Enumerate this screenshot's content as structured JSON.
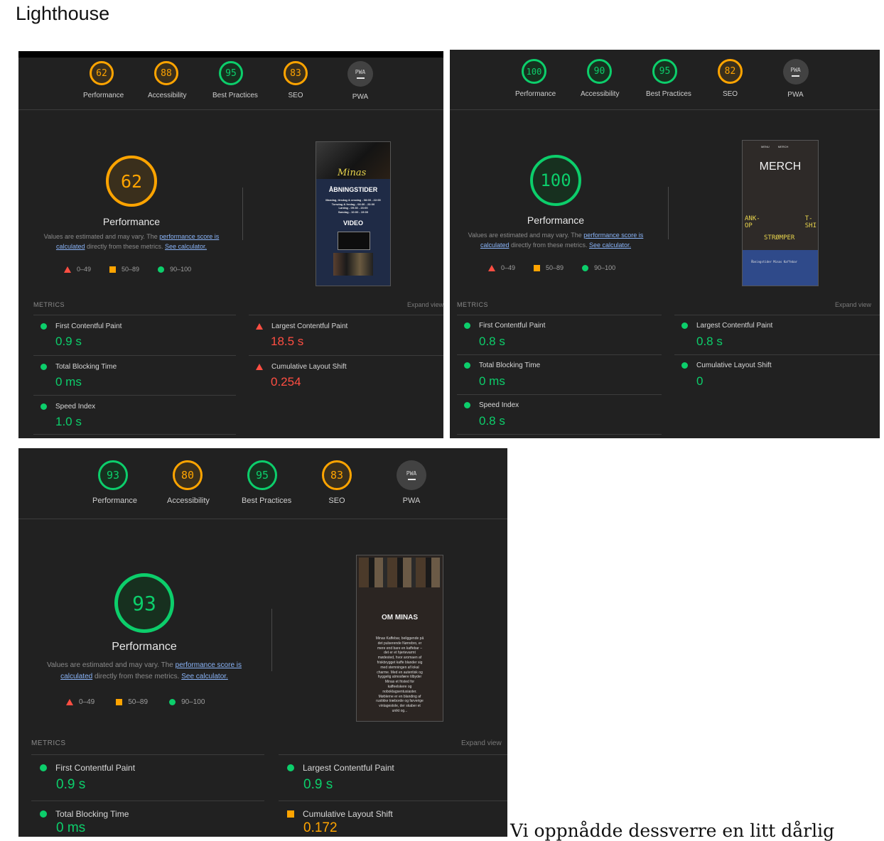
{
  "heading": "Lighthouse",
  "panels": [
    {
      "gauges": [
        {
          "score": "62",
          "label": "Performance"
        },
        {
          "score": "88",
          "label": "Accessibility"
        },
        {
          "score": "95",
          "label": "Best Practices"
        },
        {
          "score": "83",
          "label": "SEO"
        },
        {
          "score": "PWA",
          "label": "PWA"
        }
      ],
      "main_score": "62",
      "main_label": "Performance",
      "note_pre": "Values are estimated and may vary. The ",
      "note_link1": "performance score is calculated",
      "note_mid": " directly from these metrics. ",
      "note_link2": "See calculator.",
      "legend": [
        "0–49",
        "50–89",
        "90–100"
      ],
      "metrics_label": "METRICS",
      "expand": "Expand view",
      "metrics": [
        {
          "name": "First Contentful Paint",
          "value": "0.9 s",
          "status": "pass"
        },
        {
          "name": "Largest Contentful Paint",
          "value": "18.5 s",
          "status": "fail"
        },
        {
          "name": "Total Blocking Time",
          "value": "0 ms",
          "status": "pass"
        },
        {
          "name": "Cumulative Layout Shift",
          "value": "0.254",
          "status": "fail"
        },
        {
          "name": "Speed Index",
          "value": "1.0 s",
          "status": "pass"
        }
      ],
      "screenshot": {
        "heading": "ÅBNINGSTIDER",
        "script": "Minas",
        "hours": [
          "Mandag, tirsdag & onsdag - 08:00 - 22:00",
          "Torsdag & fredag - 08:30 - 23:00",
          "Lørdag - 09:30 - 23:00",
          "Søndag - 10:00 - 19:00"
        ],
        "video": "VIDEO"
      }
    },
    {
      "gauges": [
        {
          "score": "100",
          "label": "Performance"
        },
        {
          "score": "90",
          "label": "Accessibility"
        },
        {
          "score": "95",
          "label": "Best Practices"
        },
        {
          "score": "82",
          "label": "SEO"
        },
        {
          "score": "PWA",
          "label": "PWA"
        }
      ],
      "main_score": "100",
      "main_label": "Performance",
      "note_pre": "Values are estimated and may vary. The ",
      "note_link1": "performance score is calculated",
      "note_mid": " directly from these metrics. ",
      "note_link2": "See calculator.",
      "legend": [
        "0–49",
        "50–89",
        "90–100"
      ],
      "metrics_label": "METRICS",
      "expand": "Expand view",
      "metrics": [
        {
          "name": "First Contentful Paint",
          "value": "0.8 s",
          "status": "pass"
        },
        {
          "name": "Largest Contentful Paint",
          "value": "0.8 s",
          "status": "pass"
        },
        {
          "name": "Total Blocking Time",
          "value": "0 ms",
          "status": "pass"
        },
        {
          "name": "Cumulative Layout Shift",
          "value": "0",
          "status": "pass"
        },
        {
          "name": "Speed Index",
          "value": "0.8 s",
          "status": "pass"
        }
      ],
      "screenshot": {
        "nav": [
          "MENU",
          "MERCH"
        ],
        "title": "MERCH",
        "left": "ANK-\nOP",
        "right": "T-\nSHI",
        "mid": "STRØMPER",
        "footer": "Åbningstider Minas Kaffebar"
      }
    },
    {
      "gauges": [
        {
          "score": "93",
          "label": "Performance"
        },
        {
          "score": "80",
          "label": "Accessibility"
        },
        {
          "score": "95",
          "label": "Best Practices"
        },
        {
          "score": "83",
          "label": "SEO"
        },
        {
          "score": "PWA",
          "label": "PWA"
        }
      ],
      "main_score": "93",
      "main_label": "Performance",
      "note_pre": "Values are estimated and may vary. The ",
      "note_link1": "performance score is calculated",
      "note_mid": " directly from these metrics. ",
      "note_link2": "See calculator.",
      "legend": [
        "0–49",
        "50–89",
        "90–100"
      ],
      "metrics_label": "METRICS",
      "expand": "Expand view",
      "metrics": [
        {
          "name": "First Contentful Paint",
          "value": "0.9 s",
          "status": "pass"
        },
        {
          "name": "Largest Contentful Paint",
          "value": "0.9 s",
          "status": "pass"
        },
        {
          "name": "Total Blocking Time",
          "value": "0 ms",
          "status": "pass"
        },
        {
          "name": "Cumulative Layout Shift",
          "value": "0.172",
          "status": "average"
        }
      ],
      "screenshot": {
        "title": "OM MINAS",
        "text": "Minas Kaffebar, beliggende på det pulserende Nørrebro, er mere end bare en kaffebar – det er et hjertevarmt mødested, hvor aromaen af friskbrygget kaffe blander sig med stemningen af lokal charme. Med en autentisk og hyggelig atmosfære tilbyder Minas et fristed for kaffeelskere og noboklagsentusiaster. Møblerne er en blanding af rustikke træborde og farverige vintagestole, der skaber et unikt og..."
      }
    }
  ],
  "trailing_text": "Vi oppnådde dessverre en litt dårlig"
}
